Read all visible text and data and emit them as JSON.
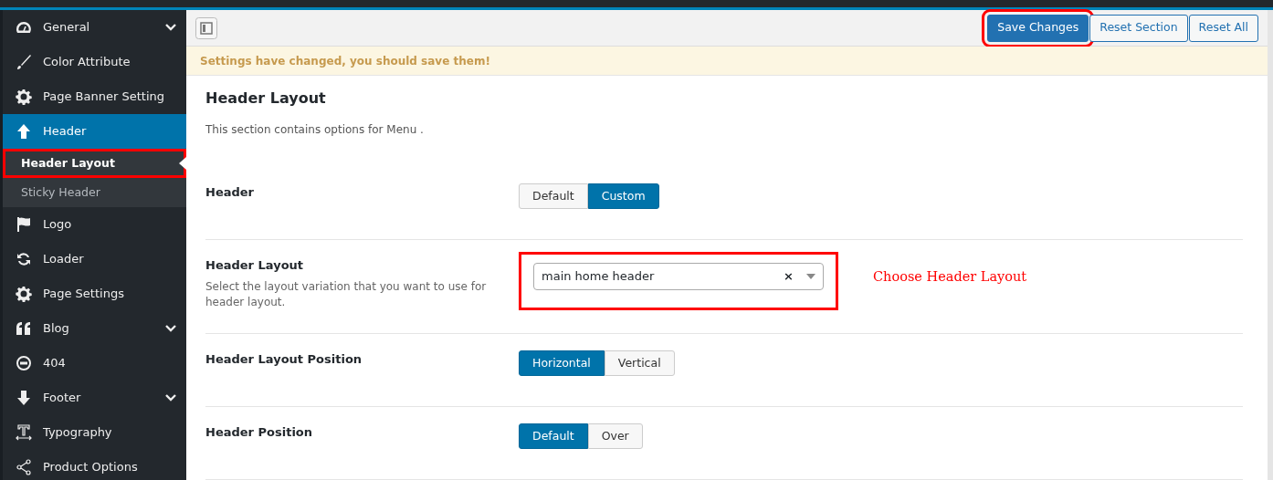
{
  "sidebar": {
    "items": [
      {
        "label": "General",
        "has_submenu": true,
        "selected": false
      },
      {
        "label": "Color Attribute",
        "has_submenu": false,
        "selected": false
      },
      {
        "label": "Page Banner Setting",
        "has_submenu": false,
        "selected": false
      },
      {
        "label": "Header",
        "has_submenu": false,
        "selected": true,
        "children": [
          {
            "label": "Header Layout",
            "selected": true,
            "highlighted": true
          },
          {
            "label": "Sticky Header",
            "selected": false,
            "highlighted": false
          }
        ]
      },
      {
        "label": "Logo",
        "has_submenu": false,
        "selected": false
      },
      {
        "label": "Loader",
        "has_submenu": false,
        "selected": false
      },
      {
        "label": "Page Settings",
        "has_submenu": false,
        "selected": false
      },
      {
        "label": "Blog",
        "has_submenu": true,
        "selected": false
      },
      {
        "label": "404",
        "has_submenu": false,
        "selected": false
      },
      {
        "label": "Footer",
        "has_submenu": true,
        "selected": false
      },
      {
        "label": "Typography",
        "has_submenu": false,
        "selected": false
      },
      {
        "label": "Product Options",
        "has_submenu": false,
        "selected": false
      }
    ]
  },
  "toolbar": {
    "buttons": [
      {
        "label": "Save Changes",
        "kind": "primary",
        "highlighted": true
      },
      {
        "label": "Reset Section",
        "kind": "secondary",
        "highlighted": false
      },
      {
        "label": "Reset All",
        "kind": "secondary",
        "highlighted": false
      }
    ]
  },
  "notice": "Settings have changed, you should save them!",
  "section": {
    "title": "Header Layout",
    "description": "This section contains options for Menu .",
    "fields": [
      {
        "label": "Header",
        "kind": "buttonset",
        "options": [
          {
            "label": "Default",
            "selected": false
          },
          {
            "label": "Custom",
            "selected": true
          }
        ]
      },
      {
        "label": "Header Layout",
        "description": "Select the layout variation that you want to use for header layout.",
        "kind": "select",
        "value": "main home header",
        "clear": "×",
        "highlighted": true,
        "annotation": "Choose Header Layout"
      },
      {
        "label": "Header Layout Position",
        "kind": "buttonset",
        "options": [
          {
            "label": "Horizontal",
            "selected": true
          },
          {
            "label": "Vertical",
            "selected": false
          }
        ]
      },
      {
        "label": "Header Position",
        "kind": "buttonset",
        "options": [
          {
            "label": "Default",
            "selected": true
          },
          {
            "label": "Over",
            "selected": false
          }
        ]
      }
    ]
  }
}
